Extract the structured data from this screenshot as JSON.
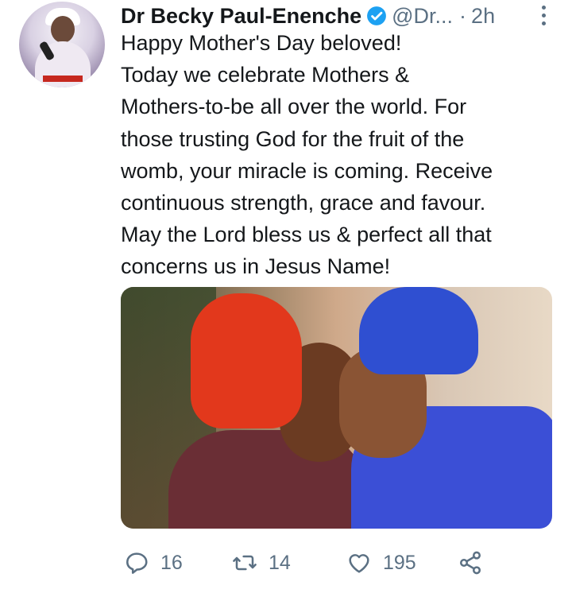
{
  "tweet": {
    "author_name": "Dr Becky Paul-Enenche",
    "handle": "@Dr...",
    "separator": "·",
    "time": "2h",
    "text_lines": [
      "Happy Mother's Day beloved!",
      "Today we celebrate Mothers &",
      "Mothers-to-be all over the world. For",
      "those trusting God for the fruit of the",
      "womb, your miracle is coming. Receive",
      "continuous strength, grace and favour.",
      "May the Lord bless us & perfect all that",
      "concerns us in Jesus Name!"
    ],
    "media": {
      "icon": "photo"
    },
    "avatar": {
      "icon": "profile-photo"
    },
    "verified_icon": "verified-badge-icon"
  },
  "actions": {
    "reply": {
      "icon": "reply-icon",
      "count": "16"
    },
    "retweet": {
      "icon": "retweet-icon",
      "count": "14"
    },
    "like": {
      "icon": "heart-icon",
      "count": "195"
    },
    "share": {
      "icon": "share-icon"
    }
  },
  "colors": {
    "text": "#14171a",
    "secondary": "#5b7083",
    "verified": "#1da1f2"
  }
}
